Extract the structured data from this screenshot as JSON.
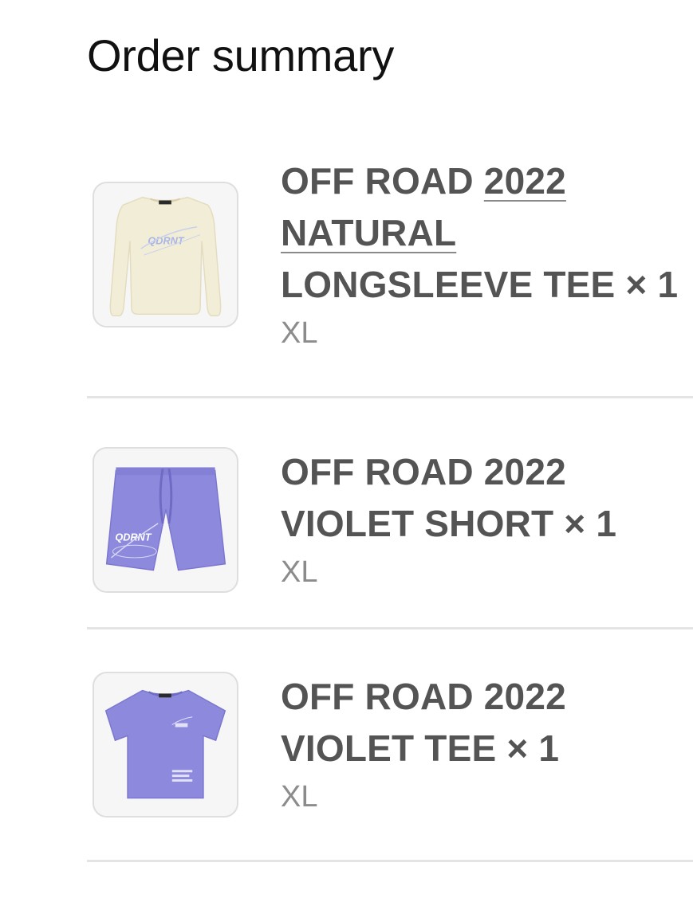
{
  "header": {
    "title": "Order summary"
  },
  "items": [
    {
      "name_prefix": "OFF ROAD ",
      "name_link_1": "2022",
      "name_link_2": "NATURAL",
      "name_suffix": "LONGSLEEVE TEE × 1",
      "variant": "XL",
      "image_icon": "longsleeve-tee-image",
      "product_color": "#f2edd6"
    },
    {
      "name_line_1": "OFF ROAD 2022",
      "name_line_2": "VIOLET SHORT × 1",
      "variant": "XL",
      "image_icon": "shorts-image",
      "product_color": "#8d8ade"
    },
    {
      "name_line_1": "OFF ROAD 2022",
      "name_line_2": "VIOLET TEE × 1",
      "variant": "XL",
      "image_icon": "tee-image",
      "product_color": "#8d8ade"
    }
  ],
  "colors": {
    "title": "#111111",
    "product_name": "#545454",
    "variant": "#8c8c8c",
    "divider": "#e4e4e4"
  }
}
